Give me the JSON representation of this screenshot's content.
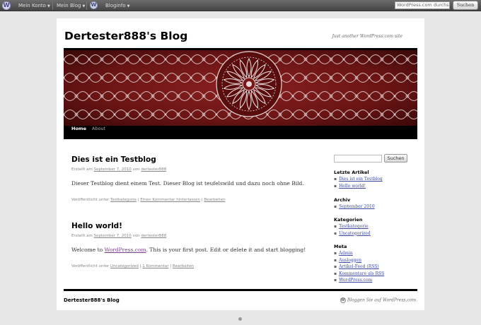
{
  "adminbar": {
    "logo_icon": "wordpress-logo-icon",
    "menu_account": "Mein Konto",
    "menu_blog": "Mein Blog",
    "menu_bloginfo": "Bloginfo",
    "search_value": "WordPress.com durchsuc",
    "search_button": "Suchen"
  },
  "header": {
    "site_title": "Dertester888's Blog",
    "description": "Just another WordPress.com site"
  },
  "nav": {
    "items": [
      {
        "label": "Home"
      },
      {
        "label": "About"
      }
    ]
  },
  "posts": [
    {
      "title": "Dies ist ein Testblog",
      "meta_prefix": "Erstellt am",
      "date": "September 7, 2010",
      "meta_by": "von",
      "author": "dertester888",
      "body": "Dieser Testblog dient einem Test. Dieser Blog ist teufelswild und dazu noch ohne Bild.",
      "footer_prefix": "Veröffentlicht unter",
      "category": "Testkategorie",
      "sep": "|",
      "comments": "Einen Kommentar hinterlassen",
      "edit": "Bearbeiten"
    },
    {
      "title": "Hello world!",
      "meta_prefix": "Erstellt am",
      "date": "September 7, 2010",
      "meta_by": "von",
      "author": "dertester888",
      "body_before": "Welcome to",
      "body_link": "WordPress.com",
      "body_after": ". This is your first post. Edit or delete it and start blogging!",
      "footer_prefix": "Veröffentlicht unter",
      "category": "Uncategorized",
      "sep": "|",
      "comments": "1 Kommentar",
      "edit": "Bearbeiten"
    }
  ],
  "sidebar": {
    "search_button": "Suchen",
    "recent_heading": "Letzte Artikel",
    "recent": [
      "Dies ist ein Testblog",
      "Hello world!"
    ],
    "archive_heading": "Archiv",
    "archive": [
      "September 2010"
    ],
    "categories_heading": "Kategorien",
    "categories": [
      "Testkategorie",
      "Uncategorized"
    ],
    "meta_heading": "Meta",
    "meta": [
      "Admin",
      "Ausloggen",
      "Artikel-Feed (RSS)",
      "Kommentare als RSS",
      "WordPress.com"
    ]
  },
  "footer": {
    "title": "Dertester888's Blog",
    "credit": "Bloggen Sie auf WordPress.com."
  },
  "colors": {
    "link": "#3b4a9c",
    "visited": "#7a3f8c",
    "banner": "#5a0d0d"
  }
}
